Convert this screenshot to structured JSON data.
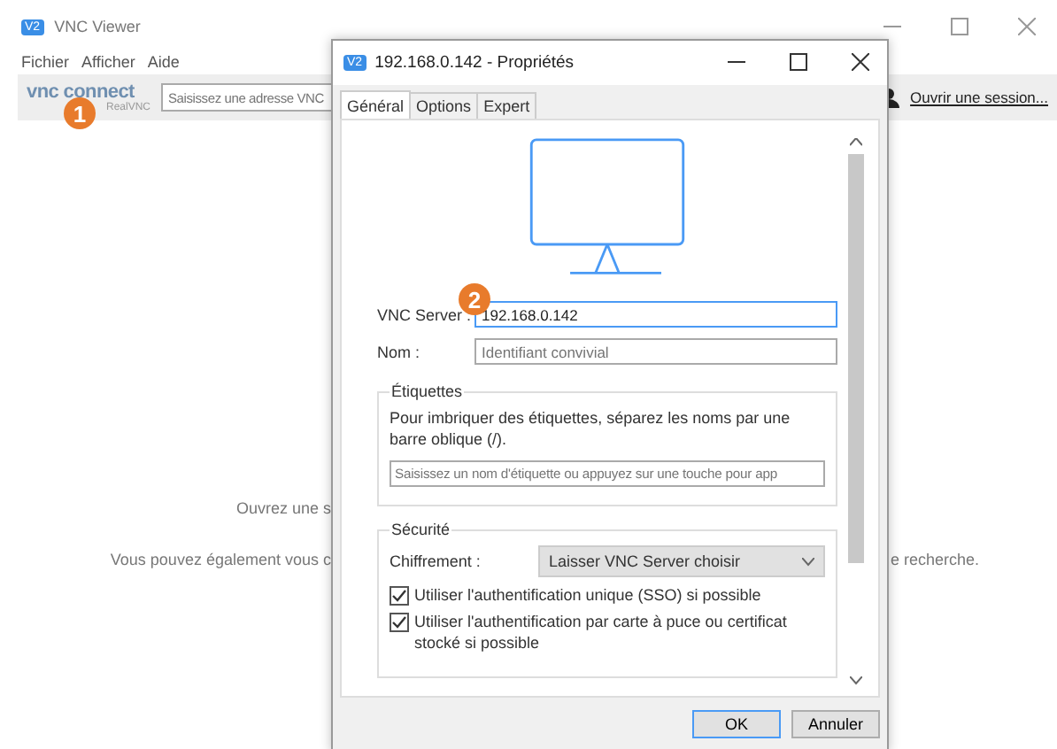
{
  "app_icon": "V2",
  "main_window": {
    "title": "VNC Viewer",
    "menu": [
      "Fichier",
      "Afficher",
      "Aide"
    ],
    "logo": {
      "name": "vnc connect",
      "byline": "RealVNC"
    },
    "search": {
      "placeholder": "Saisissez une adresse VNC"
    },
    "sign_in": "Ouvrir une session...",
    "texts": [
      {
        "left": "Ouvrez une s"
      },
      {
        "left": "Vous pouvez également vous c",
        "right": "e recherche."
      }
    ]
  },
  "dialog": {
    "app_icon": "V2",
    "title": "192.168.0.142 - Propriétés",
    "tabs": [
      {
        "label": "Général",
        "selected": true
      },
      {
        "label": "Options",
        "selected": false
      },
      {
        "label": "Expert",
        "selected": false
      }
    ],
    "server": {
      "label": "VNC Server :",
      "value": "192.168.0.142"
    },
    "name": {
      "label": "Nom :",
      "placeholder": "Identifiant convivial"
    },
    "labels_group": {
      "title": "Étiquettes",
      "hint": "Pour imbriquer des étiquettes, séparez les noms par une barre oblique (/).",
      "placeholder": "Saisissez un nom d'étiquette ou appuyez sur une touche pour app"
    },
    "security": {
      "title": "Sécurité",
      "encryption_label": "Chiffrement :",
      "encryption_value": "Laisser VNC Server choisir",
      "options": [
        {
          "label": "Utiliser l'authentification unique (SSO) si possible",
          "checked": true
        },
        {
          "label": "Utiliser l'authentification par carte à puce ou certificat stocké si possible",
          "checked": true
        }
      ]
    },
    "buttons": [
      "OK",
      "Annuler"
    ]
  },
  "callouts": [
    "1",
    "2"
  ]
}
